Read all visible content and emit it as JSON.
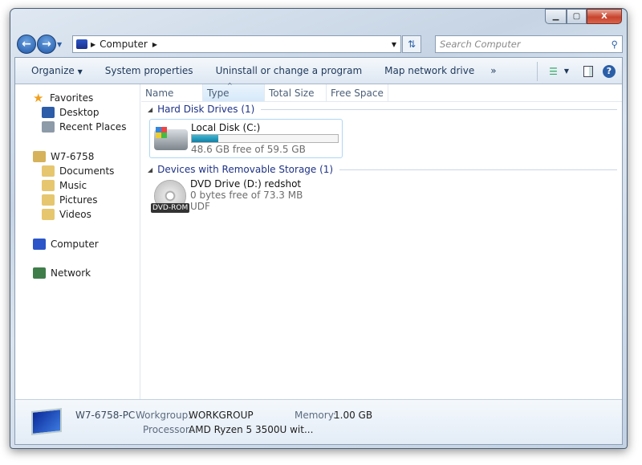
{
  "window": {
    "minimize": "▁",
    "maximize": "▢",
    "close": "X"
  },
  "address": {
    "crumbs": [
      "Computer"
    ],
    "search_placeholder": "Search Computer"
  },
  "toolbar": {
    "organize": "Organize",
    "system_properties": "System properties",
    "uninstall": "Uninstall or change a program",
    "map_drive": "Map network drive",
    "more": "»"
  },
  "nav": {
    "favorites": "Favorites",
    "desktop": "Desktop",
    "recent": "Recent Places",
    "user": "W7-6758",
    "documents": "Documents",
    "music": "Music",
    "pictures": "Pictures",
    "videos": "Videos",
    "computer": "Computer",
    "network": "Network"
  },
  "columns": [
    "Name",
    "Type",
    "Total Size",
    "Free Space"
  ],
  "groups": {
    "hdd": "Hard Disk Drives (1)",
    "removable": "Devices with Removable Storage (1)"
  },
  "drives": {
    "c": {
      "name": "Local Disk (C:)",
      "free": "48.6 GB free of 59.5 GB",
      "used_percent": 18.3
    },
    "d": {
      "name": "DVD Drive (D:) redshot",
      "free": "0 bytes free of 73.3 MB",
      "fs": "UDF",
      "badge": "DVD-ROM"
    }
  },
  "details": {
    "pc": "W7-6758-PC",
    "workgroup_label": "Workgroup:",
    "workgroup": "WORKGROUP",
    "memory_label": "Memory:",
    "memory": "1.00 GB",
    "processor_label": "Processor:",
    "processor": "AMD Ryzen 5 3500U wit..."
  }
}
